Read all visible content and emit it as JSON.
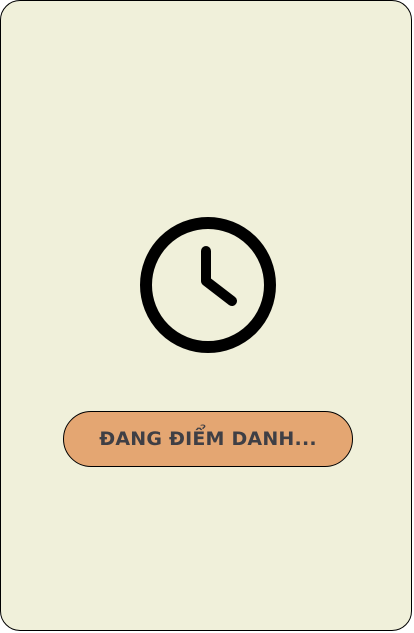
{
  "screen": {
    "background_color": "#f0f0da",
    "icon": "clock-icon",
    "status_label": "ĐANG ĐIỂM DANH...",
    "button_color": "#e4a672",
    "text_color": "#3f3f45"
  }
}
